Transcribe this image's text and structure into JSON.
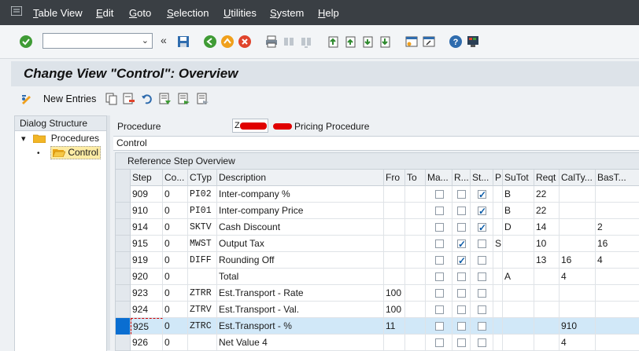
{
  "menubar": {
    "items": [
      {
        "u": "T",
        "rest": "able View"
      },
      {
        "u": "E",
        "rest": "dit"
      },
      {
        "u": "G",
        "rest": "oto"
      },
      {
        "u": "S",
        "rest": "election"
      },
      {
        "u": "U",
        "rest": "tilities"
      },
      {
        "u": "S",
        "rest": "ystem"
      },
      {
        "u": "H",
        "rest": "elp"
      }
    ]
  },
  "toolbar": {
    "command_value": "",
    "icons": [
      "enter-check-icon",
      "history-back-icon",
      "save-icon",
      "back-icon",
      "exit-icon",
      "cancel-icon",
      "print-icon",
      "find-icon",
      "find-next-icon",
      "first-page-icon",
      "previous-page-icon",
      "next-page-icon",
      "last-page-icon",
      "create-session-icon",
      "shortcut-icon",
      "help-icon",
      "customize-layout-icon"
    ]
  },
  "title": "Change View \"Control\": Overview",
  "app_toolbar": {
    "new_entries": "New Entries"
  },
  "dialog_structure": {
    "header": "Dialog Structure",
    "nodes": [
      {
        "label": "Procedures",
        "expander": "▾"
      },
      {
        "label": "Control",
        "bullet": "•"
      }
    ]
  },
  "procedure": {
    "label": "Procedure",
    "value": "Z",
    "description": "Pricing Procedure"
  },
  "control_label": "Control",
  "table": {
    "title": "Reference Step Overview",
    "columns": [
      "Step",
      "Co...",
      "CTyp",
      "Description",
      "Fro",
      "To",
      "Ma...",
      "R...",
      "St...",
      "P",
      "SuTot",
      "Reqt",
      "CalTy...",
      "BasT..."
    ],
    "rows": [
      {
        "step": "909",
        "co": "0",
        "ctyp": "PI02",
        "desc": "Inter-company %",
        "fro": "",
        "to": "",
        "ma": false,
        "r": false,
        "st": true,
        "p": "",
        "sutot": "B",
        "reqt": "22",
        "calty": "",
        "bast": ""
      },
      {
        "step": "910",
        "co": "0",
        "ctyp": "PI01",
        "desc": "Inter-company Price",
        "fro": "",
        "to": "",
        "ma": false,
        "r": false,
        "st": true,
        "p": "",
        "sutot": "B",
        "reqt": "22",
        "calty": "",
        "bast": ""
      },
      {
        "step": "914",
        "co": "0",
        "ctyp": "SKTV",
        "desc": "Cash Discount",
        "fro": "",
        "to": "",
        "ma": false,
        "r": false,
        "st": true,
        "p": "",
        "sutot": "D",
        "reqt": "14",
        "calty": "",
        "bast": "2"
      },
      {
        "step": "915",
        "co": "0",
        "ctyp": "MWST",
        "desc": "Output Tax",
        "fro": "",
        "to": "",
        "ma": false,
        "r": true,
        "st": false,
        "p": "S",
        "sutot": "",
        "reqt": "10",
        "calty": "",
        "bast": "16"
      },
      {
        "step": "919",
        "co": "0",
        "ctyp": "DIFF",
        "desc": "Rounding Off",
        "fro": "",
        "to": "",
        "ma": false,
        "r": true,
        "st": false,
        "p": "",
        "sutot": "",
        "reqt": "13",
        "calty": "16",
        "bast": "4"
      },
      {
        "step": "920",
        "co": "0",
        "ctyp": "",
        "desc": "Total",
        "fro": "",
        "to": "",
        "ma": false,
        "r": false,
        "st": false,
        "p": "",
        "sutot": "A",
        "reqt": "",
        "calty": "4",
        "bast": ""
      },
      {
        "step": "923",
        "co": "0",
        "ctyp": "ZTRR",
        "desc": "Est.Transport - Rate",
        "fro": "100",
        "to": "",
        "ma": false,
        "r": false,
        "st": false,
        "p": "",
        "sutot": "",
        "reqt": "",
        "calty": "",
        "bast": ""
      },
      {
        "step": "924",
        "co": "0",
        "ctyp": "ZTRV",
        "desc": "Est.Transport - Val.",
        "fro": "100",
        "to": "",
        "ma": false,
        "r": false,
        "st": false,
        "p": "",
        "sutot": "",
        "reqt": "",
        "calty": "",
        "bast": ""
      },
      {
        "step": "925",
        "co": "0",
        "ctyp": "ZTRC",
        "desc": "Est.Transport - %",
        "fro": "11",
        "to": "",
        "ma": false,
        "r": false,
        "st": false,
        "p": "",
        "sutot": "",
        "reqt": "",
        "calty": "910",
        "bast": ""
      },
      {
        "step": "926",
        "co": "0",
        "ctyp": "",
        "desc": "Net Value 4",
        "fro": "",
        "to": "",
        "ma": false,
        "r": false,
        "st": false,
        "p": "",
        "sutot": "",
        "reqt": "",
        "calty": "4",
        "bast": ""
      }
    ],
    "selected_row_index": 8
  },
  "colors": {
    "menubar_bg": "#3a3f44",
    "title_bg": "#dde3e9",
    "selection_blue": "#0a6ed1",
    "row_highlight": "#d1e8f8",
    "check_blue": "#0a5ba8"
  }
}
